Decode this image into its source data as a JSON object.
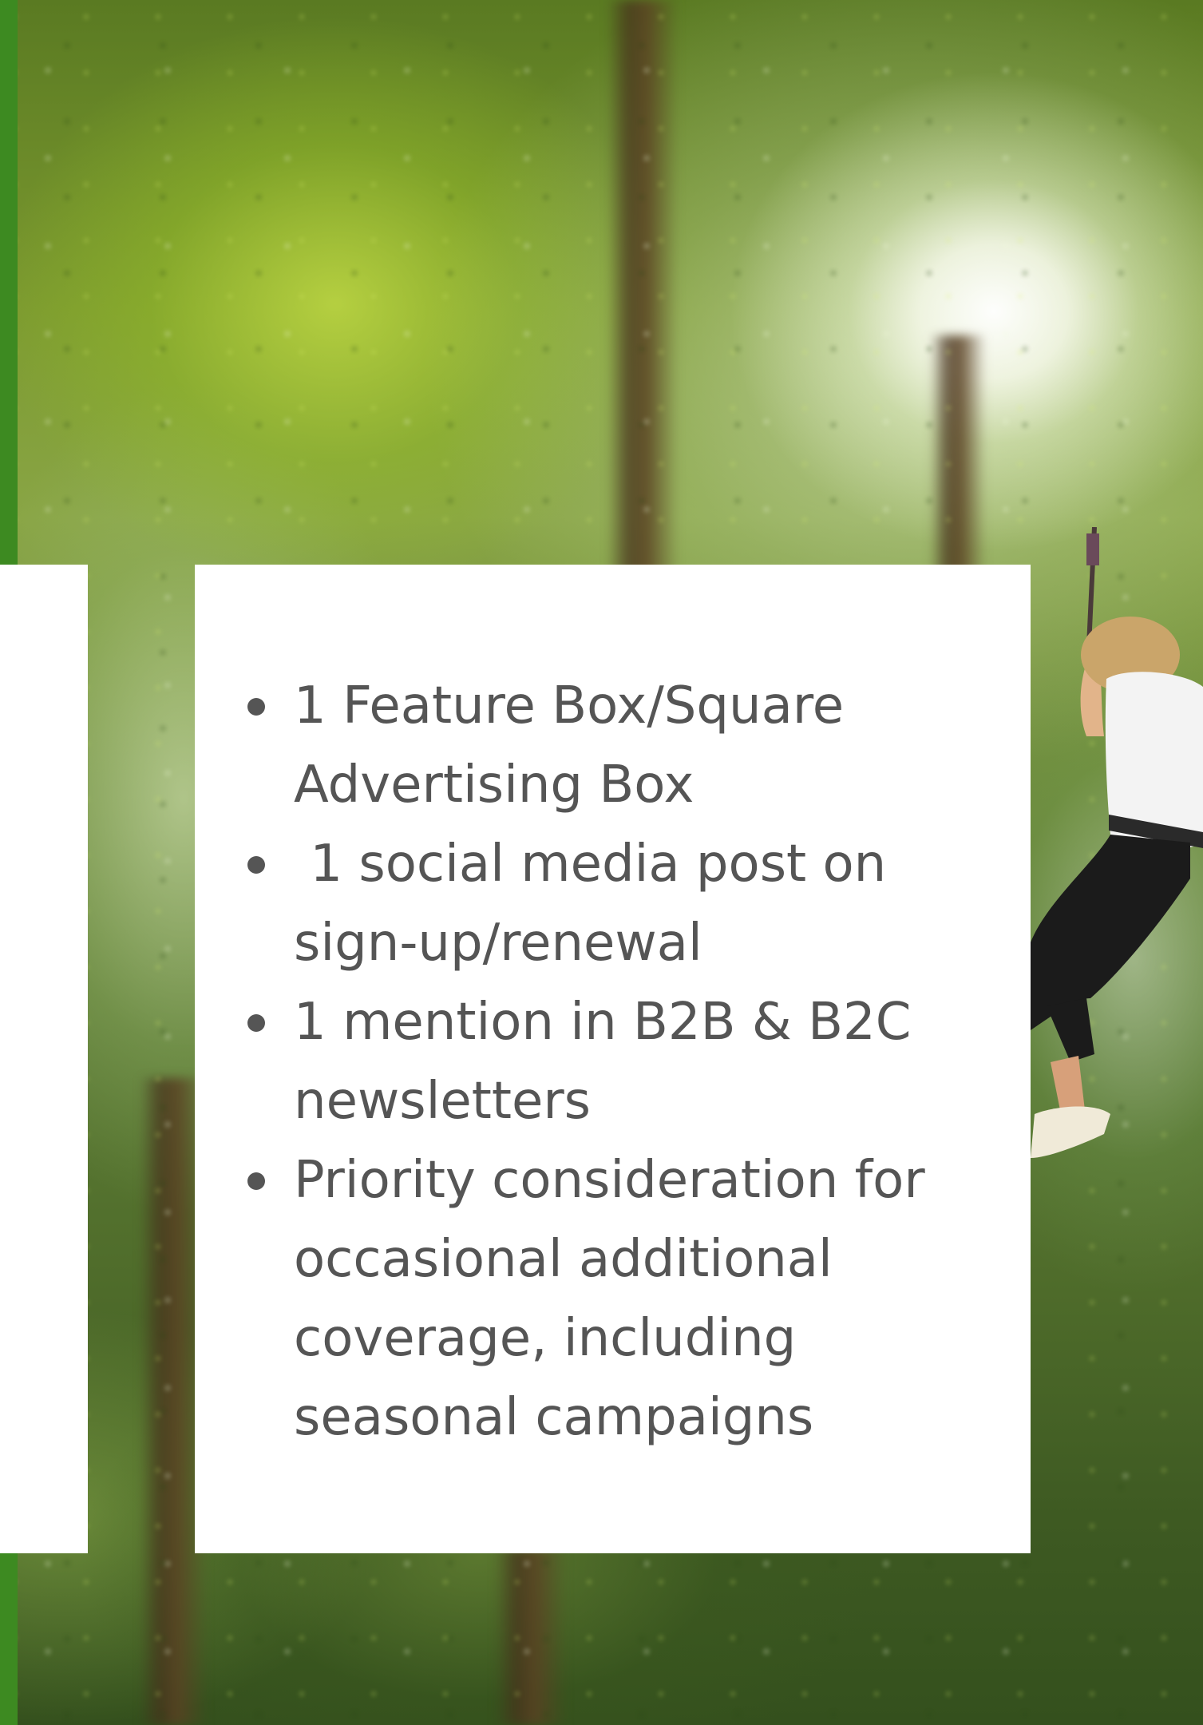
{
  "colors": {
    "card_background": "#ffffff",
    "text": "#555555",
    "accent_strip": "#3d8a21"
  },
  "benefits": [
    {
      "text": "1 Feature Box/Square Advertising Box"
    },
    {
      "text": " 1 social media post on sign-up/renewal"
    },
    {
      "text": "1 mention in B2B & B2C newsletters"
    },
    {
      "text": "Priority consideration for occasional additional coverage, including seasonal campaigns"
    }
  ],
  "icons": {
    "list_bullet": "bullet-dot-icon",
    "rider_image": "zipline-rider-icon"
  }
}
